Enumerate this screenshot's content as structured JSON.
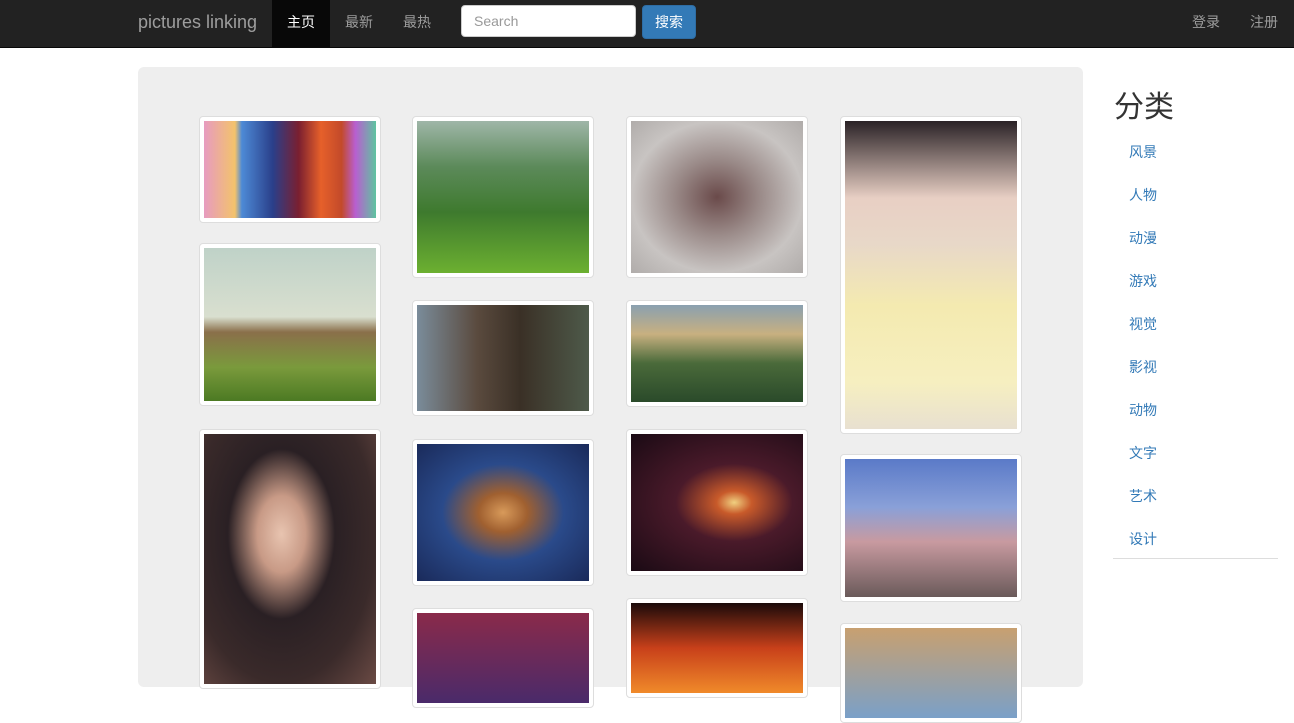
{
  "navbar": {
    "brand": "pictures linking",
    "items": [
      {
        "label": "主页",
        "active": true
      },
      {
        "label": "最新"
      },
      {
        "label": "最热"
      }
    ],
    "search_placeholder": "Search",
    "search_button": "搜索",
    "login": "登录",
    "register": "注册"
  },
  "sidebar": {
    "title": "分类",
    "categories": [
      "风景",
      "人物",
      "动漫",
      "游戏",
      "视觉",
      "影视",
      "动物",
      "文字",
      "艺术",
      "设计"
    ]
  }
}
